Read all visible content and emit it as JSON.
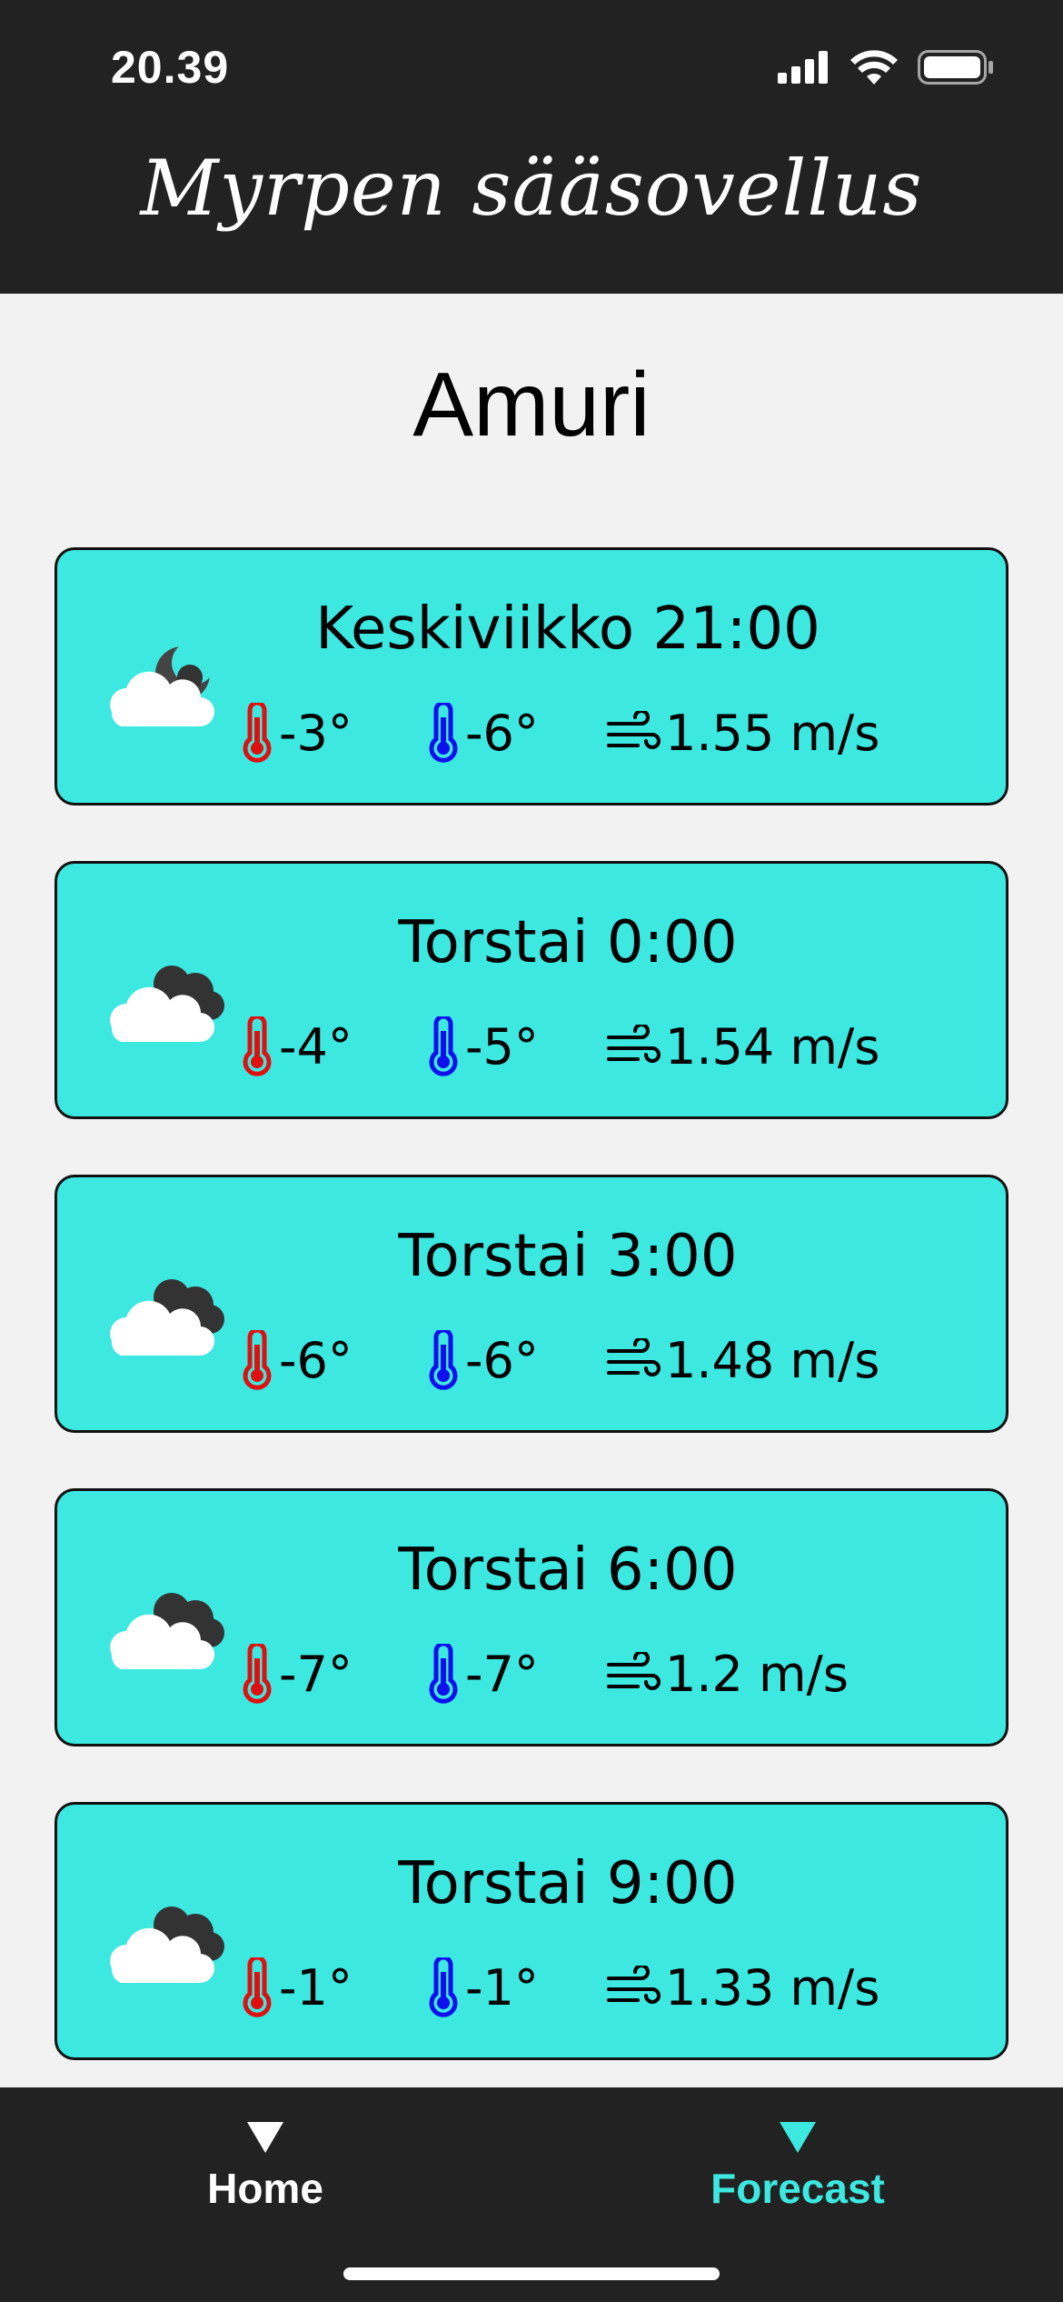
{
  "status_bar": {
    "time": "20.39",
    "icons": [
      "signal-icon",
      "wifi-icon",
      "battery-icon"
    ]
  },
  "header": {
    "title": "Myrpen sääsovellus"
  },
  "city": "Amuri",
  "forecast": [
    {
      "title": "Keskiviikko 21:00",
      "max": "-3°",
      "min": "-6°",
      "wind": "1.55 m/s",
      "icon": "cloudy-night-icon"
    },
    {
      "title": "Torstai 0:00",
      "max": "-4°",
      "min": "-5°",
      "wind": "1.54 m/s",
      "icon": "cloudy-icon"
    },
    {
      "title": "Torstai 3:00",
      "max": "-6°",
      "min": "-6°",
      "wind": "1.48 m/s",
      "icon": "cloudy-icon"
    },
    {
      "title": "Torstai 6:00",
      "max": "-7°",
      "min": "-7°",
      "wind": "1.2 m/s",
      "icon": "cloudy-icon"
    },
    {
      "title": "Torstai 9:00",
      "max": "-1°",
      "min": "-1°",
      "wind": "1.33 m/s",
      "icon": "cloudy-icon"
    }
  ],
  "nav": {
    "home_label": "Home",
    "forecast_label": "Forecast",
    "active": "Forecast"
  },
  "colors": {
    "header_bg": "#222222",
    "card_bg": "#3de8e0",
    "accent": "#3de8e0",
    "max_temp": "#e01010",
    "min_temp": "#1010ee"
  }
}
